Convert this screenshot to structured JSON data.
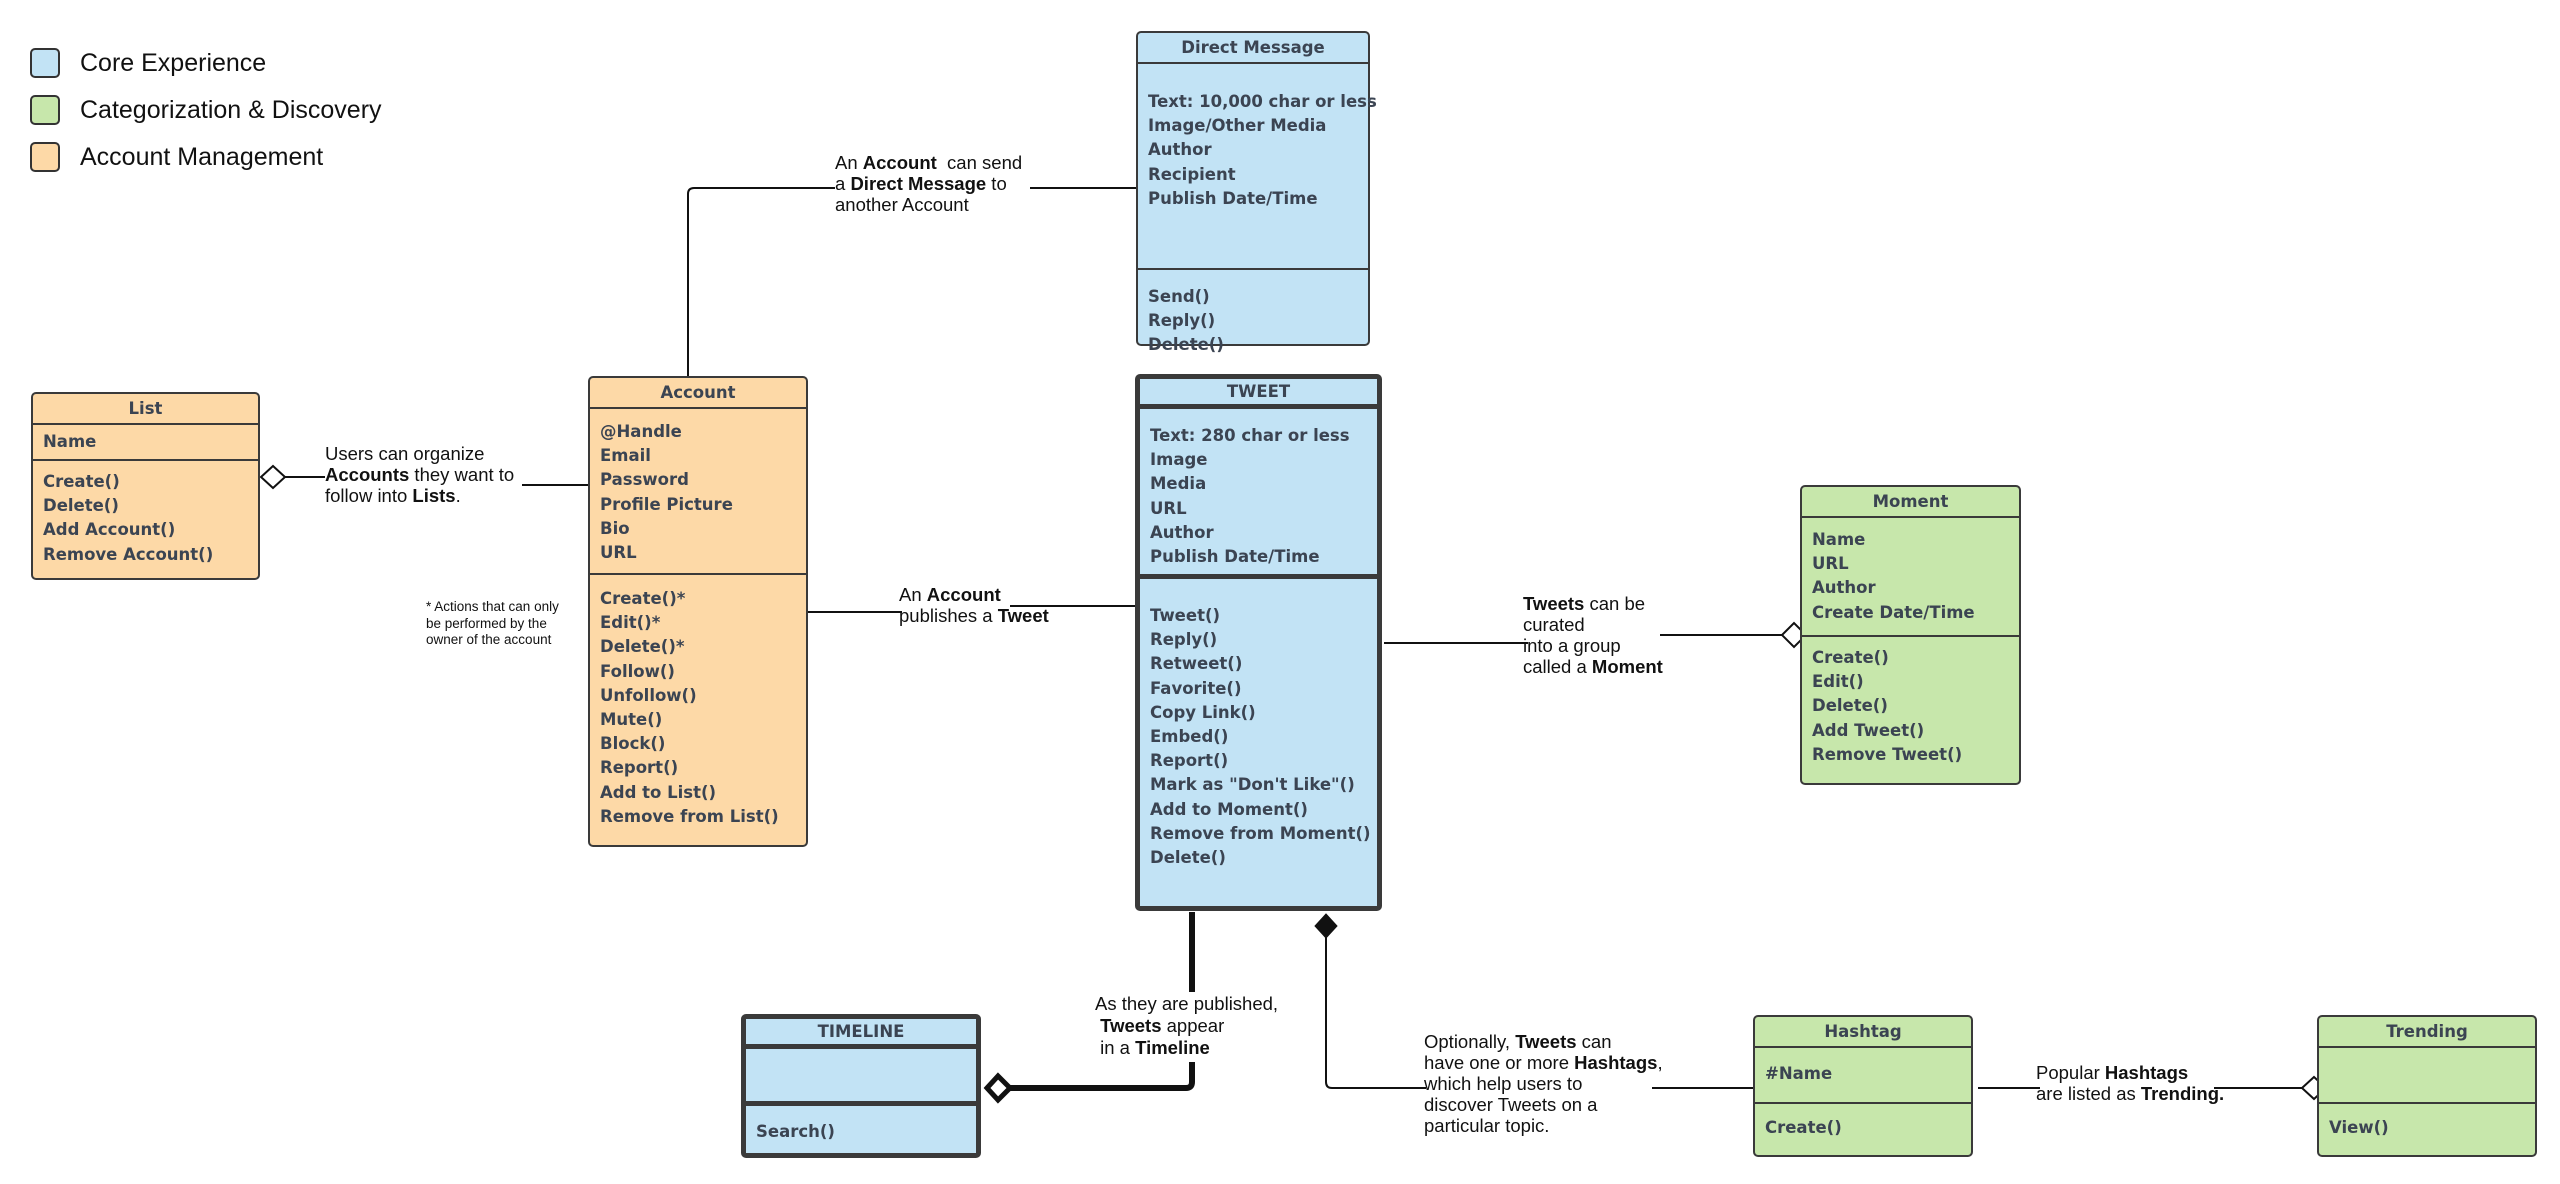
{
  "legend": [
    {
      "label": "Core Experience",
      "color": "#c2e3f5"
    },
    {
      "label": "Categorization & Discovery",
      "color": "#c7e7ab"
    },
    {
      "label": "Account Management",
      "color": "#fdd9a7"
    }
  ],
  "classes": {
    "direct_message": {
      "title": "Direct Message",
      "attributes": [
        "Text: 10,000 char or less",
        "Image/Other Media",
        "Author",
        "Recipient",
        "Publish Date/Time"
      ],
      "methods": [
        "Send()",
        "Reply()",
        "Delete()"
      ]
    },
    "list": {
      "title": "List",
      "attributes": [
        "Name"
      ],
      "methods": [
        "Create()",
        "Delete()",
        "Add Account()",
        "Remove Account()"
      ]
    },
    "account": {
      "title": "Account",
      "attributes": [
        "@Handle",
        "Email",
        "Password",
        "Profile Picture",
        "Bio",
        "URL"
      ],
      "methods": [
        "Create()*",
        "Edit()*",
        "Delete()*",
        "Follow()",
        "Unfollow()",
        "Mute()",
        "Block()",
        "Report()",
        "Add to List()",
        "Remove from List()"
      ]
    },
    "tweet": {
      "title": "TWEET",
      "attributes": [
        "Text: 280 char or less",
        "Image",
        "Media",
        "URL",
        "Author",
        "Publish Date/Time"
      ],
      "methods": [
        "Tweet()",
        "Reply()",
        "Retweet()",
        "Favorite()",
        "Copy Link()",
        "Embed()",
        "Report()",
        "Mark as \"Don't Like\"()",
        "Add to Moment()",
        "Remove from Moment()",
        "Delete()"
      ]
    },
    "moment": {
      "title": "Moment",
      "attributes": [
        "Name",
        "URL",
        "Author",
        "Create Date/Time"
      ],
      "methods": [
        "Create()",
        "Edit()",
        "Delete()",
        "Add Tweet()",
        "Remove Tweet()"
      ]
    },
    "timeline": {
      "title": "TIMELINE",
      "attributes": [],
      "methods": [
        "Search()"
      ]
    },
    "hashtag": {
      "title": "Hashtag",
      "attributes": [
        "#Name"
      ],
      "methods": [
        "Create()"
      ]
    },
    "trending": {
      "title": "Trending",
      "attributes": [],
      "methods": [
        "View()"
      ]
    }
  },
  "notes": {
    "dm": [
      [
        {
          "t": "An "
        },
        {
          "t": "Account",
          "b": true
        },
        {
          "t": "  can send"
        }
      ],
      [
        {
          "t": "a "
        },
        {
          "t": "Direct Message",
          "b": true
        },
        {
          "t": " to"
        }
      ],
      [
        {
          "t": "another Account"
        }
      ]
    ],
    "list": [
      [
        {
          "t": "Users can organize"
        }
      ],
      [
        {
          "t": "Accounts",
          "b": true
        },
        {
          "t": " they want to"
        }
      ],
      [
        {
          "t": "follow into "
        },
        {
          "t": "Lists",
          "b": true
        },
        {
          "t": "."
        }
      ]
    ],
    "publish": [
      [
        {
          "t": "An "
        },
        {
          "t": "Account",
          "b": true
        }
      ],
      [
        {
          "t": "publishes a "
        },
        {
          "t": "Tweet",
          "b": true
        }
      ]
    ],
    "moment": [
      [
        {
          "t": "Tweets",
          "b": true
        },
        {
          "t": " can be"
        }
      ],
      [
        {
          "t": "curated"
        }
      ],
      [
        {
          "t": "into a group"
        }
      ],
      [
        {
          "t": "called a "
        },
        {
          "t": "Moment",
          "b": true
        }
      ]
    ],
    "timeline": [
      [
        {
          "t": "As they are published,"
        }
      ],
      [
        {
          "t": " "
        },
        {
          "t": "Tweets",
          "b": true
        },
        {
          "t": " appear"
        }
      ],
      [
        {
          "t": " in a "
        },
        {
          "t": "Timeline",
          "b": true
        }
      ]
    ],
    "hashtag": [
      [
        {
          "t": "Optionally, "
        },
        {
          "t": "Tweets",
          "b": true
        },
        {
          "t": " can"
        }
      ],
      [
        {
          "t": "have one or more "
        },
        {
          "t": "Hashtags",
          "b": true
        },
        {
          "t": ","
        }
      ],
      [
        {
          "t": "which help users to"
        }
      ],
      [
        {
          "t": "discover Tweets on a"
        }
      ],
      [
        {
          "t": "particular topic."
        }
      ]
    ],
    "trending": [
      [
        {
          "t": "Popular "
        },
        {
          "t": "Hashtags",
          "b": true
        }
      ],
      [
        {
          "t": "are listed as "
        },
        {
          "t": "Trending.",
          "b": true
        }
      ]
    ]
  },
  "footnote": "* Actions that can only be performed by the owner of the account"
}
